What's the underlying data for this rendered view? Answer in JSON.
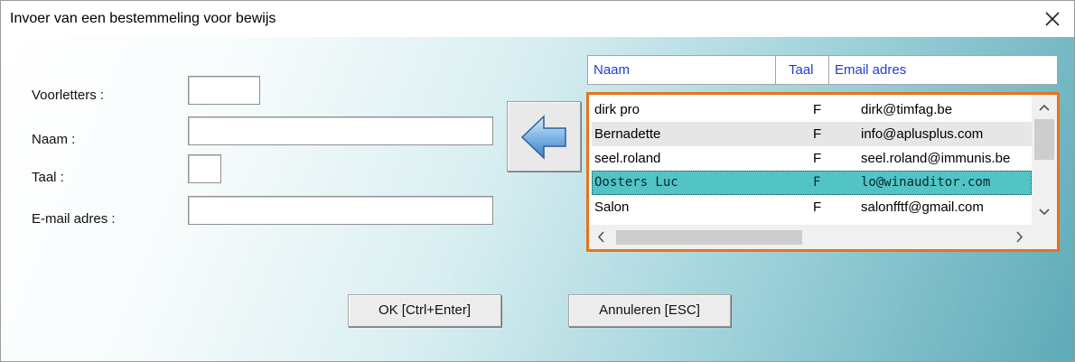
{
  "window": {
    "title": "Invoer van een bestemmeling voor bewijs",
    "close_glyph": "×"
  },
  "form": {
    "initials_label": "Voorletters :",
    "name_label": "Naam :",
    "language_label": "Taal :",
    "email_label": "E-mail adres :",
    "initials_value": "",
    "name_value": "",
    "language_value": "",
    "email_value": ""
  },
  "grid": {
    "columns": [
      "Naam",
      "Taal",
      "Email adres"
    ],
    "rows": [
      {
        "name": "dirk pro",
        "taal": "F",
        "email": "dirk@timfag.be"
      },
      {
        "name": "Bernadette",
        "taal": "F",
        "email": "info@aplusplus.com"
      },
      {
        "name": "seel.roland",
        "taal": "F",
        "email": "seel.roland@immunis.be"
      },
      {
        "name": "Oosters Luc",
        "taal": "F",
        "email": "lo@winauditor.com"
      },
      {
        "name": "Salon",
        "taal": "F",
        "email": "salonfftf@gmail.com"
      }
    ],
    "selected_index": 3,
    "accent_border": "#e8731a",
    "selected_color": "#52c4c6"
  },
  "buttons": {
    "ok_label": "OK [Ctrl+Enter]",
    "cancel_label": "Annuleren [ESC]",
    "arrow_icon": "left-arrow-icon"
  }
}
